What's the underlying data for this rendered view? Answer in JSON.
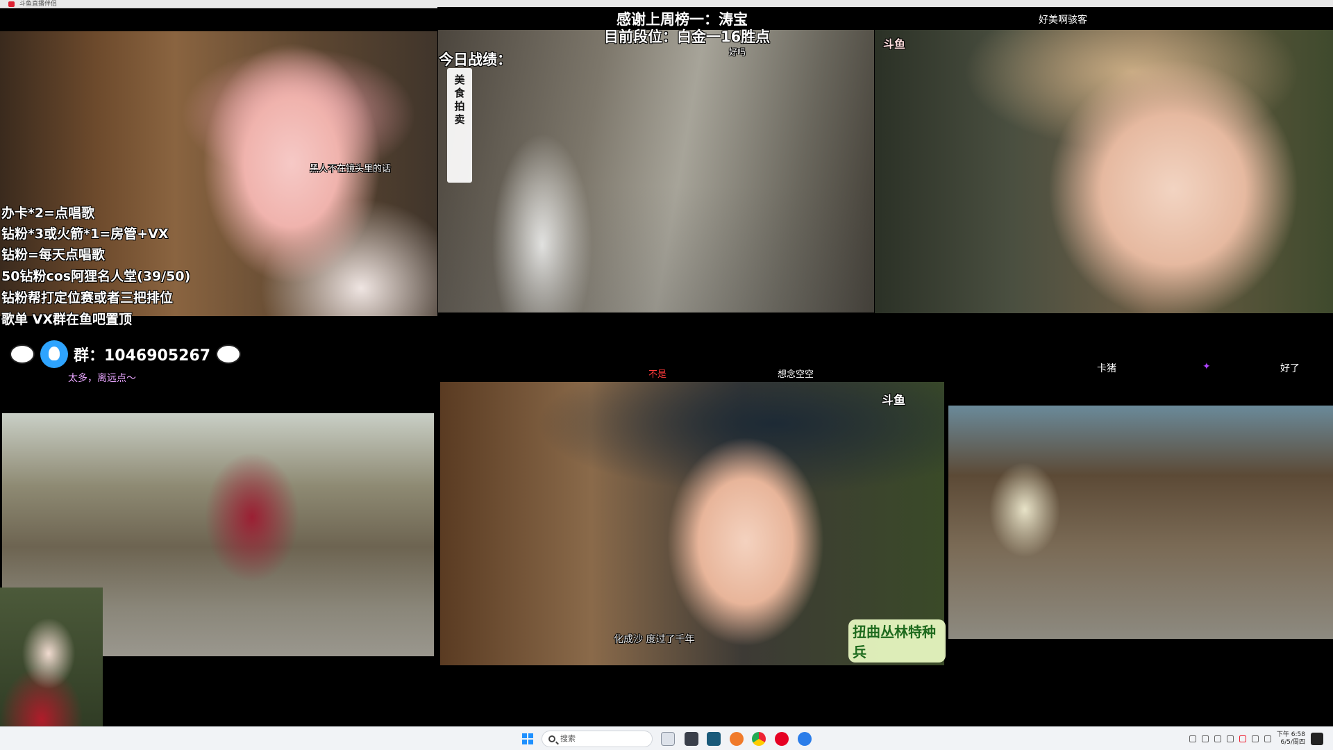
{
  "window": {
    "title": "斗鱼直播伴侣"
  },
  "panes": {
    "top_center": {
      "header": {
        "thanks": "感谢上周榜一：涛宝",
        "rank": "目前段位：白金一16胜点",
        "record": "今日战绩："
      },
      "vertical_sign": [
        "美",
        "食",
        "拍",
        "卖"
      ],
      "chat_snippet": "好吗"
    },
    "top_left": {
      "danmu": "黑人不在镜头里的话"
    },
    "top_right": {
      "danmu": "好美啊骇客",
      "brand": "斗鱼"
    },
    "bottom_left": {
      "danmu": "太多，离远点～"
    },
    "bottom_center": {
      "danmu_top": [
        "不是",
        "想念空空"
      ],
      "subtitle": "化成沙 度过了千年",
      "brand": "斗鱼",
      "show_logo": "扭曲丛林特种兵"
    },
    "bottom_right": {
      "danmu": [
        "卡猪",
        "好了"
      ]
    }
  },
  "info_lines": [
    "办卡*2=点唱歌",
    "钻粉*3或火箭*1=房管+VX",
    "钻粉=每天点唱歌",
    "50钻粉cos阿狸名人堂(39/50)",
    "钻粉帮打定位赛或者三把排位",
    "歌单 VX群在鱼吧置顶"
  ],
  "group": {
    "label": "群：1046905267"
  },
  "taskbar": {
    "search_placeholder": "搜索",
    "time": "下午 6:58",
    "date": "6/5/周四"
  },
  "colors": {
    "accent_red": "#ff3b3b",
    "accent_purple": "#b044ff",
    "taskbar_bg": "#f1f3f6"
  }
}
